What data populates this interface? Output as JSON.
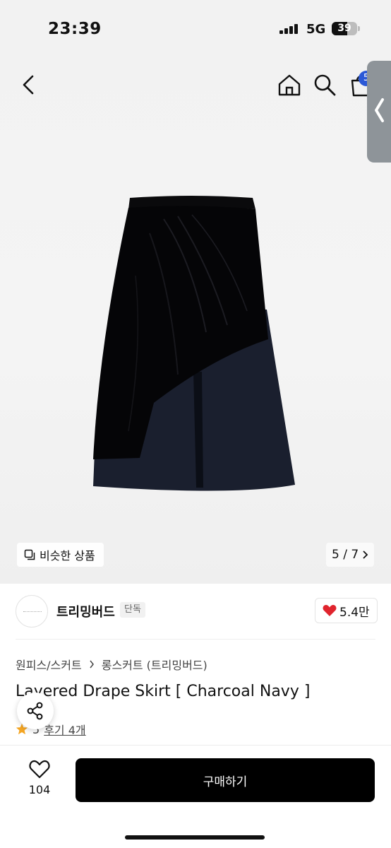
{
  "status": {
    "time": "23:39",
    "network": "5G",
    "battery": "39"
  },
  "nav": {
    "cart_badge": "5"
  },
  "gallery": {
    "similar_label": "비슷한 상품",
    "counter": "5 / 7"
  },
  "brand": {
    "name": "트리밍버드",
    "tag": "단독",
    "likes": "5.4만"
  },
  "product": {
    "breadcrumb": [
      "원피스/스커트",
      "롱스커트 (트리밍버드)"
    ],
    "title": "Layered Drape Skirt [ Charcoal Navy ]",
    "rating": "5",
    "reviews": "후기 4개"
  },
  "bottom": {
    "wish_count": "104",
    "buy_label": "구매하기"
  },
  "colors": {
    "accent": "#2b58d6",
    "heart": "#e0242d",
    "star": "#f5a623"
  }
}
